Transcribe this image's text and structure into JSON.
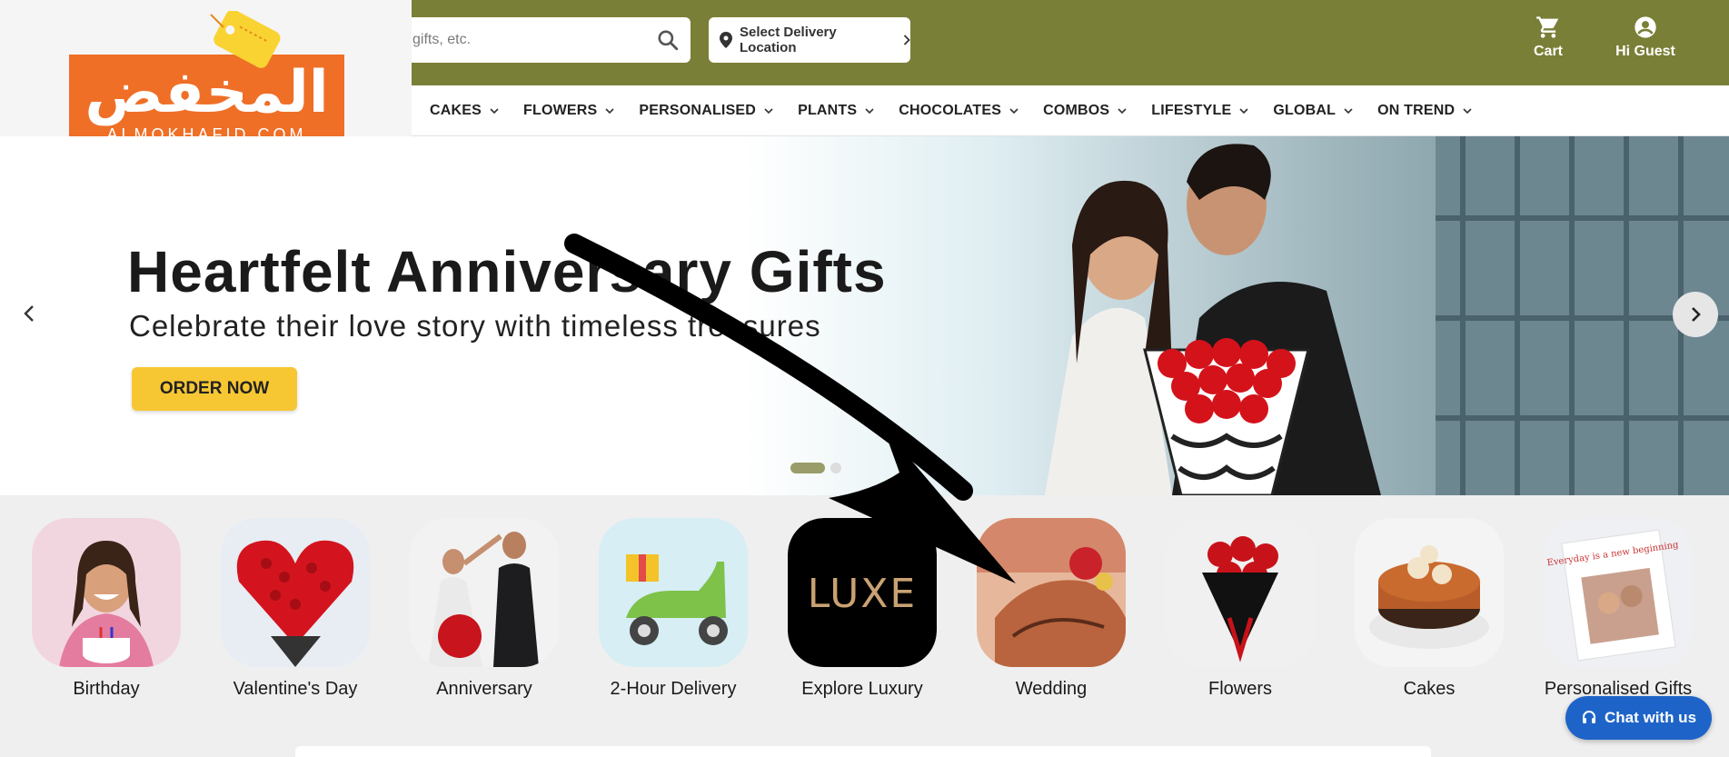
{
  "header": {
    "search_placeholder": "gifts, etc.",
    "delivery_location": "Select Delivery Location",
    "cart_label": "Cart",
    "user_label": "Hi Guest"
  },
  "logo": {
    "arabic": "المخفض",
    "english": "ALMOKHAFID.COM"
  },
  "nav": {
    "items": [
      "CAKES",
      "FLOWERS",
      "PERSONALISED",
      "PLANTS",
      "CHOCOLATES",
      "COMBOS",
      "LIFESTYLE",
      "GLOBAL",
      "ON TREND"
    ]
  },
  "hero": {
    "title": "Heartfelt Anniversary Gifts",
    "subtitle": "Celebrate their love story with timeless treasures",
    "cta": "ORDER NOW",
    "slides_total": 2,
    "active_slide": 1
  },
  "categories": [
    {
      "label": "Birthday",
      "icon": "birthday-photo"
    },
    {
      "label": "Valentine's Day",
      "icon": "rose-heart-photo"
    },
    {
      "label": "Anniversary",
      "icon": "couple-dance-photo"
    },
    {
      "label": "2-Hour Delivery",
      "icon": "scooter-photo"
    },
    {
      "label": "Explore Luxury",
      "icon": "luxe-logo",
      "badge": "LUXE"
    },
    {
      "label": "Wedding",
      "icon": "henna-hands-photo"
    },
    {
      "label": "Flowers",
      "icon": "bouquet-photo"
    },
    {
      "label": "Cakes",
      "icon": "cake-photo"
    },
    {
      "label": "Personalised Gifts",
      "icon": "photo-frame-photo",
      "frame_text": "Everyday is a new beginning"
    }
  ],
  "chat": {
    "label": "Chat with us"
  },
  "colors": {
    "header_bg": "#7a7f37",
    "logo_orange": "#ef6f27",
    "cta_yellow": "#f7c733",
    "chat_blue": "#1e64c8"
  }
}
